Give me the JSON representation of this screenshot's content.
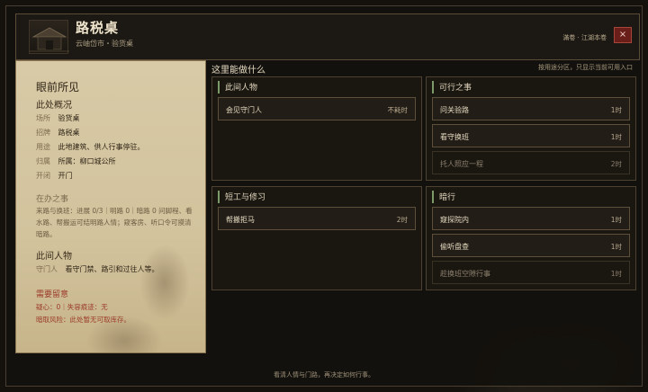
{
  "header": {
    "title": "路税桌",
    "subtitle": "云岫岱市・验货桌",
    "region_label": "滿卷 · 江湖本卷",
    "close_label": "×"
  },
  "left": {
    "heading": "眼前所见",
    "overview_title": "此处概况",
    "fields": [
      {
        "k": "场所",
        "v": "验货桌"
      },
      {
        "k": "招牌",
        "v": "路税桌"
      },
      {
        "k": "用途",
        "v": "此地建筑、供人行事停驻。"
      },
      {
        "k": "归属",
        "v": "所属：柳口城公所"
      },
      {
        "k": "开闭",
        "v": "开门"
      }
    ],
    "pending_title": "在办之事",
    "pending_text": "来路与换班：进展 0/3｜明路 0｜暗路 0 问脚程、看水路、帮搬运可结明路人情；窥客房、听口令可摸清暗路。",
    "people_title": "此间人物",
    "people": {
      "k": "守门人",
      "v": "看守门禁、路引和过往人等。"
    },
    "warn_title": "需要留意",
    "warn_lines": [
      "疑心：0｜失容痕迹：无",
      "暗取风险：此处暂无可取库存。"
    ]
  },
  "right": {
    "title": "这里能做什么",
    "hint": "按用途分区，只显示当前可用入口",
    "panels": [
      {
        "title": "此间人物",
        "actions": [
          {
            "label": "会见守门人",
            "cost": "不耗时",
            "dim": false
          }
        ]
      },
      {
        "title": "可行之事",
        "actions": [
          {
            "label": "问关验路",
            "cost": "1时",
            "dim": false
          },
          {
            "label": "看守换班",
            "cost": "1时",
            "dim": false
          },
          {
            "label": "托人照应一程",
            "cost": "2时",
            "dim": true
          }
        ]
      },
      {
        "title": "短工与修习",
        "actions": [
          {
            "label": "帮搬拒马",
            "cost": "2时",
            "dim": false
          }
        ]
      },
      {
        "title": "暗行",
        "actions": [
          {
            "label": "窥探院内",
            "cost": "1时",
            "dim": false
          },
          {
            "label": "偷听盘查",
            "cost": "1时",
            "dim": false
          },
          {
            "label": "趁换班空隙行事",
            "cost": "1时",
            "dim": true
          }
        ]
      }
    ]
  },
  "footer": "看清人情与门路，再决定如何行事。"
}
